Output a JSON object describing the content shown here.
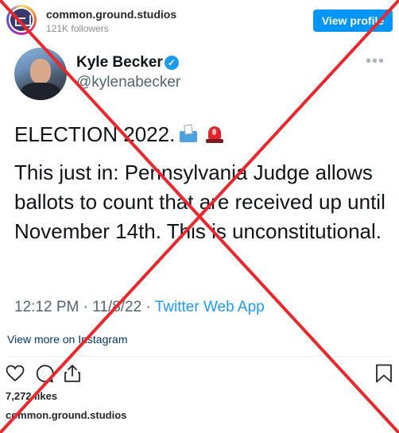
{
  "post_header": {
    "account_name": "common.ground.studios",
    "followers": "121K followers",
    "view_profile_label": "View profile"
  },
  "tweet": {
    "author_name": "Kyle Becker",
    "verified_glyph": "✓",
    "handle": "@kylenabecker",
    "more_glyph": "•••",
    "headline": "ELECTION 2022.",
    "headline_icons": [
      "ballot-box-icon",
      "siren-icon"
    ],
    "body": "This just in: Pennsylvania Judge allows ballots to count that are received up until November 14th. This is unconstitutional.",
    "time": "12:12 PM · 11/8/22 · ",
    "source": "Twitter Web App"
  },
  "footer": {
    "view_more_label": "View more on Instagram",
    "likes": "7,272 likes",
    "caption_user": "common.ground.studios"
  },
  "overlay": {
    "type": "red-x",
    "color": "#e8282c"
  },
  "colors": {
    "instagram_blue": "#0095f6",
    "twitter_blue": "#1d9bf0",
    "link_dark_blue": "#00376b"
  }
}
